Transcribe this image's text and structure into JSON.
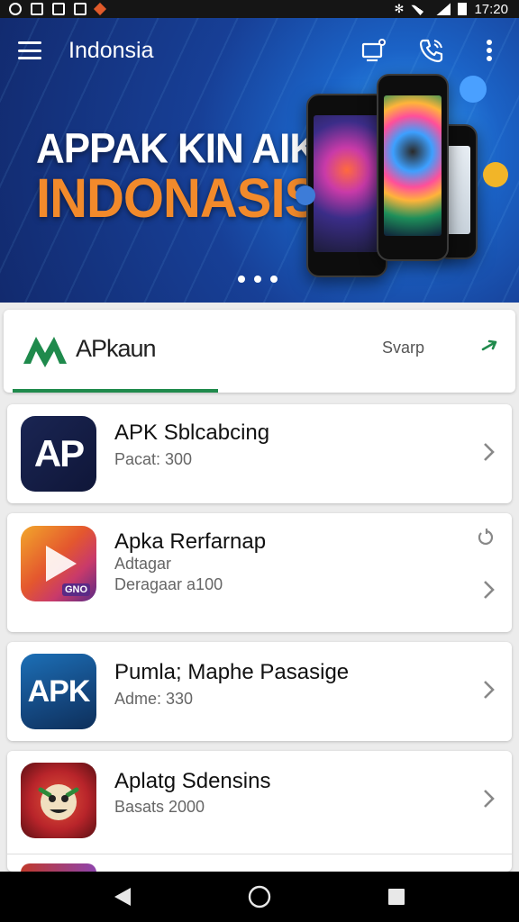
{
  "status_bar": {
    "time": "17:20"
  },
  "app_bar": {
    "title": "Indonsia"
  },
  "hero": {
    "headline_line1": "APPAK KIN AIK",
    "headline_line2": "INDONASISA",
    "carousel_dots": 3
  },
  "brand": {
    "name": "APkaun",
    "action_label": "Svarp",
    "colors": {
      "logo": "#1f8a4c",
      "underline": "#1f8a4c"
    }
  },
  "apps": [
    {
      "title": "APK Sblcabcing",
      "subtitle": "Pacat: 300",
      "icon_text": "AP"
    },
    {
      "title": "Apka Rerfarnap",
      "subtitle": "Adtagar",
      "subtitle2": "Deragaar a100",
      "icon_text": "GNO"
    },
    {
      "title": "Pumla; Maphe Pasasige",
      "subtitle": "Adme: 330",
      "icon_text": "APK"
    },
    {
      "title": "Aplatg Sdensins",
      "subtitle": "Basats 2000"
    }
  ],
  "colors": {
    "accent_green": "#1f8a4c",
    "hero_blue": "#173f96",
    "headline_orange": "#f28a2b"
  }
}
